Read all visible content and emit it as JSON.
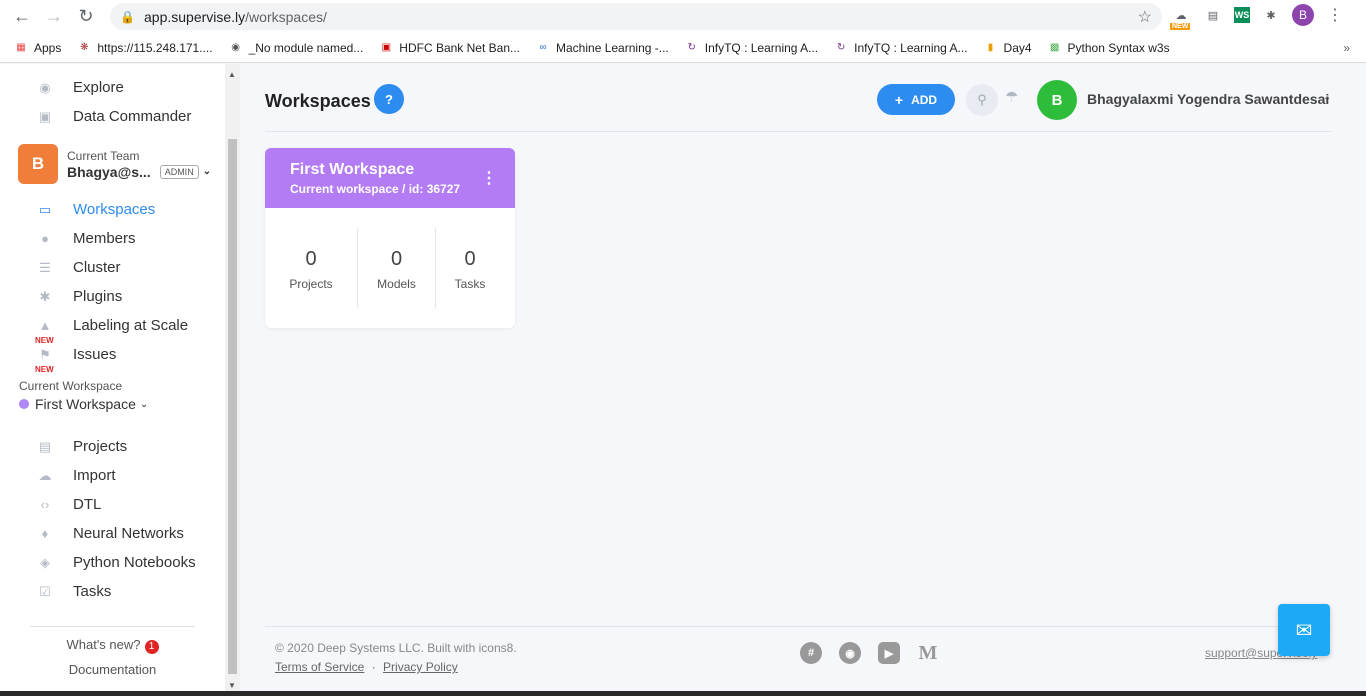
{
  "browser": {
    "url_host": "app.supervise.ly",
    "url_path": "/workspaces/",
    "profile_initial": "B",
    "ext_new_label": "NEW",
    "ext_ws_label": "WS",
    "bookmarks": [
      {
        "label": "Apps",
        "icon": "apps-grid-icon"
      },
      {
        "label": "https://115.248.171....",
        "icon": "site-icon"
      },
      {
        "label": "_No module named...",
        "icon": "globe-icon"
      },
      {
        "label": "HDFC Bank Net Ban...",
        "icon": "hdfc-icon"
      },
      {
        "label": "Machine Learning -...",
        "icon": "coursera-icon"
      },
      {
        "label": "InfyTQ : Learning A...",
        "icon": "infytq-icon"
      },
      {
        "label": "InfyTQ : Learning A...",
        "icon": "infytq-icon"
      },
      {
        "label": "Day4",
        "icon": "book-icon"
      },
      {
        "label": "Python Syntax w3s",
        "icon": "w3s-icon"
      }
    ]
  },
  "sidebar": {
    "top_items": [
      {
        "label": "Explore",
        "icon": "globe-icon"
      },
      {
        "label": "Data Commander",
        "icon": "folder-icon"
      }
    ],
    "team": {
      "avatar": "B",
      "label": "Current Team",
      "name": "Bhagya@s...",
      "role": "ADMIN"
    },
    "team_items": [
      {
        "label": "Workspaces",
        "icon": "monitor-icon",
        "active": true
      },
      {
        "label": "Members",
        "icon": "members-icon"
      },
      {
        "label": "Cluster",
        "icon": "cluster-icon"
      },
      {
        "label": "Plugins",
        "icon": "puzzle-icon"
      },
      {
        "label": "Labeling at Scale",
        "icon": "graduation-icon",
        "new": "NEW"
      },
      {
        "label": "Issues",
        "icon": "flag-icon",
        "new": "NEW"
      }
    ],
    "workspace": {
      "label": "Current Workspace",
      "name": "First Workspace"
    },
    "workspace_items": [
      {
        "label": "Projects",
        "icon": "images-icon"
      },
      {
        "label": "Import",
        "icon": "cloud-upload-icon"
      },
      {
        "label": "DTL",
        "icon": "code-icon"
      },
      {
        "label": "Neural Networks",
        "icon": "fire-icon"
      },
      {
        "label": "Python Notebooks",
        "icon": "python-icon"
      },
      {
        "label": "Tasks",
        "icon": "check-icon"
      }
    ],
    "whats_new": "What's new?",
    "whats_new_count": "1",
    "documentation": "Documentation"
  },
  "header": {
    "title": "Workspaces",
    "help": "?",
    "add_label": "ADD",
    "user_initial": "B",
    "user_name": "Bhagyalaxmi Yogendra Sawantdesai"
  },
  "workspace_card": {
    "title": "First Workspace",
    "subtitle": "Current workspace  / id: 36727",
    "color": "#b47cf4",
    "stats": [
      {
        "value": "0",
        "label": "Projects"
      },
      {
        "value": "0",
        "label": "Models"
      },
      {
        "value": "0",
        "label": "Tasks"
      }
    ]
  },
  "footer": {
    "copyright": "© 2020 Deep Systems LLC. Built with icons8.",
    "terms": "Terms of Service",
    "separator": "·",
    "privacy": "Privacy Policy",
    "support": "support@supervisely"
  },
  "colors": {
    "accent": "#2d8cf0",
    "team_avatar": "#f07d3a",
    "user_avatar": "#2ebd3a",
    "workspace_dot": "#b086f5"
  }
}
